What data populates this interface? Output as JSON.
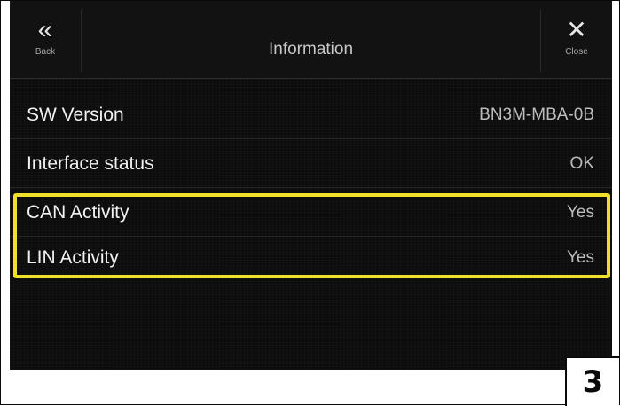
{
  "header": {
    "back_label": "Back",
    "back_glyph": "«",
    "title": "Information",
    "close_label": "Close",
    "close_glyph": "✕"
  },
  "rows": [
    {
      "label": "SW Version",
      "value": "BN3M-MBA-0B"
    },
    {
      "label": "Interface status",
      "value": "OK"
    },
    {
      "label": "CAN Activity",
      "value": "Yes"
    },
    {
      "label": "LIN Activity",
      "value": "Yes"
    }
  ],
  "highlight_color": "#f0e02a",
  "page_number": "3",
  "icons": {
    "back": "double-chevron-left-icon",
    "close": "close-icon"
  }
}
